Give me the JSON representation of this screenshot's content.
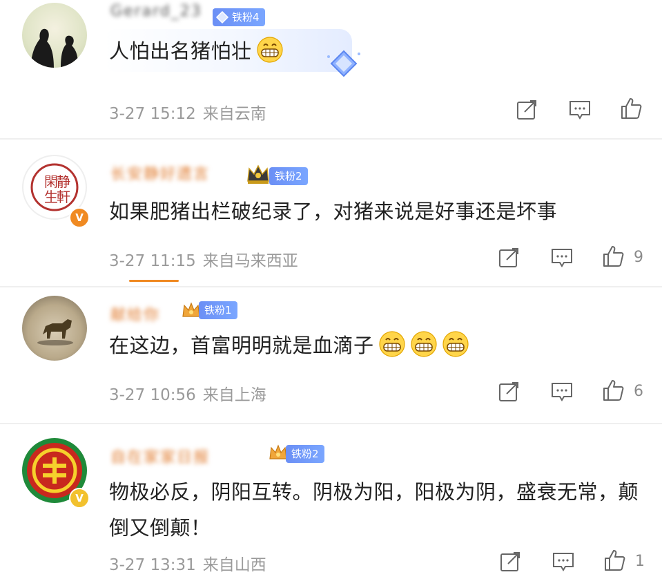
{
  "comments": [
    {
      "username": "Gerard_23",
      "fan_badge": "铁粉4",
      "text": "人怕出名猪怕壮",
      "emoji_count": 1,
      "time": "3-27 15:12",
      "location": "来自云南",
      "likes": ""
    },
    {
      "username": "长安静好遗言",
      "fan_badge": "铁粉2",
      "text": "如果肥猪出栏破纪录了，对猪来说是好事还是坏事",
      "emoji_count": 0,
      "time": "3-27 11:15",
      "location": "来自马来西亚",
      "likes": "9"
    },
    {
      "username": "献给你",
      "fan_badge": "铁粉1",
      "text": "在这边，首富明明就是血滴子",
      "emoji_count": 3,
      "time": "3-27 10:56",
      "location": "来自上海",
      "likes": "6"
    },
    {
      "username": "自在家家日报",
      "fan_badge": "铁粉2",
      "text": "物极必反，阴阳互转。阴极为阳，阳极为阴，盛衰无常，颠倒又倒颠！",
      "emoji_count": 0,
      "time": "3-27 13:31",
      "location": "来自山西",
      "likes": "1"
    }
  ],
  "icons": {
    "share": "share-icon",
    "comment": "comment-icon",
    "like": "like-icon",
    "emoji": "grin-emoji"
  },
  "colors": {
    "fan_badge": "#6b8ff5",
    "username_orange": "#e07b2e",
    "meta_gray": "#9a9a9a",
    "v_orange": "#f08a22",
    "v_yellow": "#f2c12e"
  }
}
